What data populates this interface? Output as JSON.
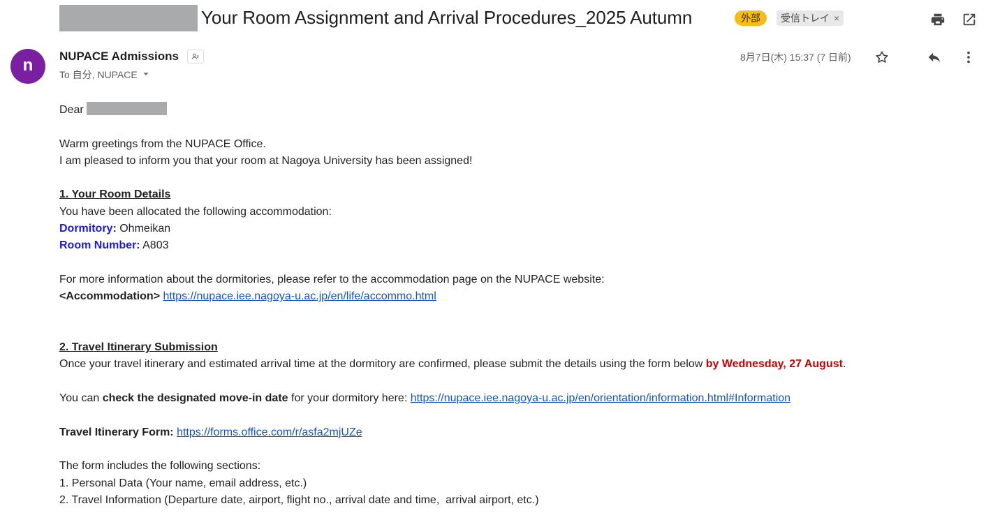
{
  "header": {
    "subject": "Your Room Assignment and Arrival Procedures_2025 Autumn",
    "chip_external": "外部",
    "chip_inbox": "受信トレイ",
    "chip_remove": "×"
  },
  "sender": {
    "avatar_letter": "n",
    "avatar_color": "#7b1fa2",
    "name": "NUPACE Admissions",
    "to_line": "To 自分, NUPACE",
    "date": "8月7日(木) 15:37 (7 日前)"
  },
  "icons": {
    "print": "print-icon",
    "open_new": "open-in-new-window-icon",
    "star": "star-icon",
    "reply": "reply-icon",
    "more": "more-vertical-icon"
  },
  "body": {
    "greeting": "Dear",
    "line1": "Warm greetings from the NUPACE Office.",
    "line2": "I am pleased to inform you that your room at Nagoya University has been assigned!",
    "section1_title": "1. Your Room Details",
    "section1_intro": "You have been allocated the following accommodation:",
    "dormitory_label": "Dormitory:",
    "dormitory_value": " Ohmeikan",
    "room_label": "Room Number:",
    "room_value": " A803",
    "more_info": "For more information about the dormitories, please refer to the accommodation page on the NUPACE website:",
    "accommodation_label": "<Accommodation>",
    "accommodation_link": "https://nupace.iee.nagoya-u.ac.jp/en/life/accommo.html",
    "section2_title": "2. Travel Itinerary Submission",
    "section2_text": "Once your travel itinerary and estimated arrival time at the dormitory are confirmed, please submit the details using the form below ",
    "deadline": "by Wednesday, 27 August",
    "deadline_end": ".",
    "movein_pre": "You can ",
    "movein_bold": "check the designated move-in date",
    "movein_post": " for your dormitory here: ",
    "movein_link": "https://nupace.iee.nagoya-u.ac.jp/en/orientation/information.html#Information",
    "form_label": "Travel Itinerary Form:",
    "form_link": "https://forms.office.com/r/asfa2mjUZe",
    "sections_intro": "The form includes the following sections:",
    "sections_item1": "1. Personal Data (Your name, email address, etc.)",
    "sections_item2": "2. Travel Information (Departure date, airport, flight no., arrival date and time,  arrival airport, etc.)"
  }
}
